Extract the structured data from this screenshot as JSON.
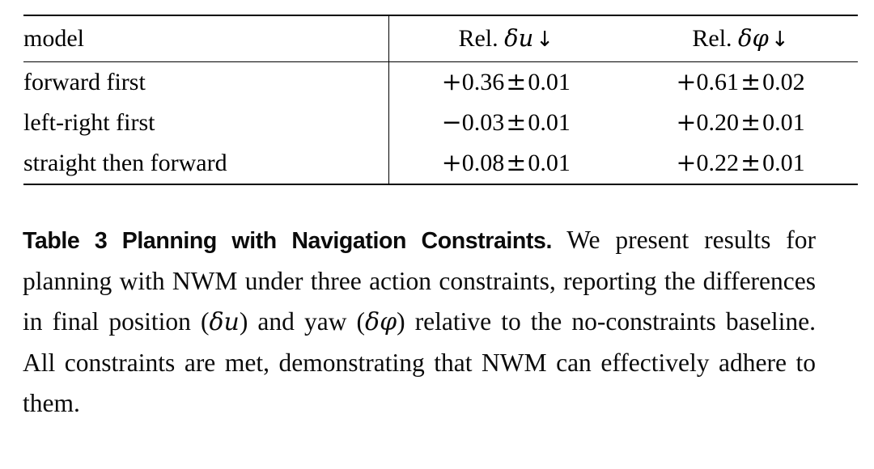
{
  "table": {
    "columns": [
      {
        "id": "model",
        "label": "model",
        "align": "left"
      },
      {
        "id": "rel_du",
        "label_prefix": "Rel.",
        "label_symbol": "δu",
        "label_arrow": "↓",
        "align": "center"
      },
      {
        "id": "rel_dphi",
        "label_prefix": "Rel.",
        "label_symbol": "δφ",
        "label_arrow": "↓",
        "align": "center"
      }
    ],
    "rows": [
      {
        "model": "forward first",
        "rel_du": {
          "sign": "+",
          "value": "0.36",
          "pm": "±",
          "err": "0.01"
        },
        "rel_dphi": {
          "sign": "+",
          "value": "0.61",
          "pm": "±",
          "err": "0.02"
        }
      },
      {
        "model": "left-right first",
        "rel_du": {
          "sign": "−",
          "value": "0.03",
          "pm": "±",
          "err": "0.01"
        },
        "rel_dphi": {
          "sign": "+",
          "value": "0.20",
          "pm": "±",
          "err": "0.01"
        }
      },
      {
        "model": "straight then forward",
        "rel_du": {
          "sign": "+",
          "value": "0.08",
          "pm": "±",
          "err": "0.01"
        },
        "rel_dphi": {
          "sign": "+",
          "value": "0.22",
          "pm": "±",
          "err": "0.01"
        }
      }
    ]
  },
  "caption": {
    "title": "Table 3  Planning with Navigation Constraints.",
    "body_part_1": " We present results for planning with NWM under three action constraints, reporting the differences in final position (",
    "math_1": "δu",
    "body_part_2": ") and yaw (",
    "math_2": "δφ",
    "body_part_3": ") relative to the no-constraints baseline. All constraints are met, demonstrating that NWM can effectively adhere to them."
  },
  "colors": {
    "text": "#000000",
    "rule": "#000000",
    "background": "#ffffff"
  }
}
